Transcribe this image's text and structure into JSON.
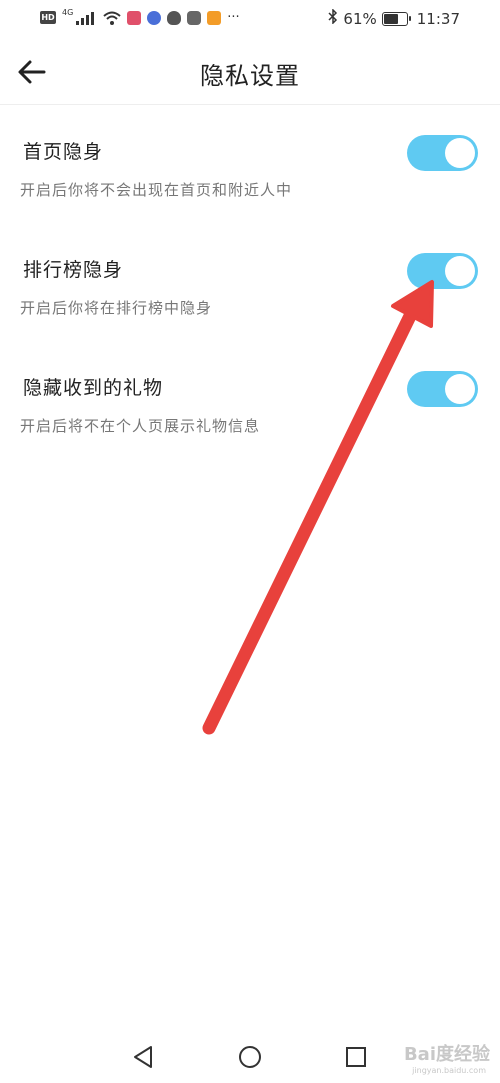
{
  "status_bar": {
    "network_label": "4G",
    "hd_label": "HD",
    "more_label": "···",
    "battery_percent": "61%",
    "time": "11:37",
    "battery_level": 0.61
  },
  "header": {
    "title": "隐私设置"
  },
  "settings": [
    {
      "title": "首页隐身",
      "description": "开启后你将不会出现在首页和附近人中",
      "enabled": true
    },
    {
      "title": "排行榜隐身",
      "description": "开启后你将在排行榜中隐身",
      "enabled": true
    },
    {
      "title": "隐藏收到的礼物",
      "description": "开启后将不在个人页展示礼物信息",
      "enabled": true
    }
  ],
  "colors": {
    "toggle_on": "#5fcaf2",
    "arrow": "#e8413c"
  },
  "watermark": {
    "main": "Bai度经验",
    "sub": "jingyan.baidu.com"
  }
}
